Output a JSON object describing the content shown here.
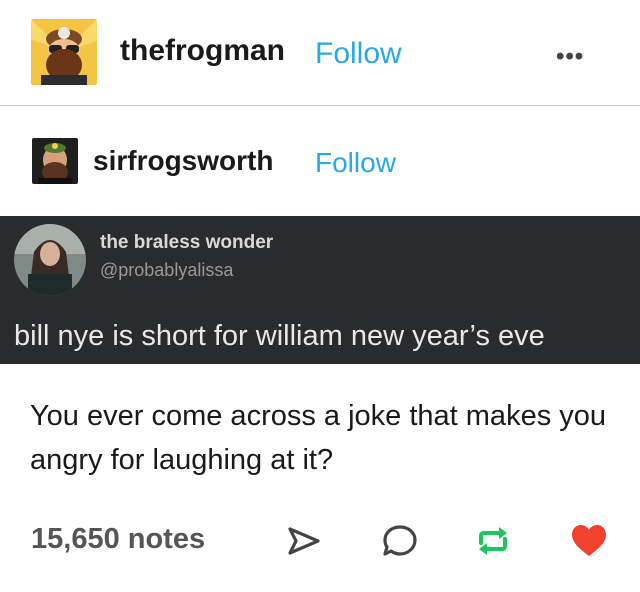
{
  "post": {
    "author": "thefrogman",
    "follow_label": "Follow",
    "more_label": "•••"
  },
  "reblog": {
    "author": "sirfrogsworth",
    "follow_label": "Follow"
  },
  "tweet": {
    "display_name": "the braless wonder",
    "handle": "@probablyalissa",
    "text": "bill nye is short for william new year’s eve"
  },
  "caption": "You ever come across a joke that makes you angry for laughing at it?",
  "footer": {
    "notes": "15,650 notes"
  },
  "colors": {
    "follow": "#2aa8e4",
    "reblog_green": "#1ec45e",
    "like_red": "#f2412e",
    "tweet_bg": "#2a2b2d"
  },
  "icons": [
    "share-icon",
    "reply-icon",
    "reblog-icon",
    "like-icon",
    "more-icon"
  ]
}
